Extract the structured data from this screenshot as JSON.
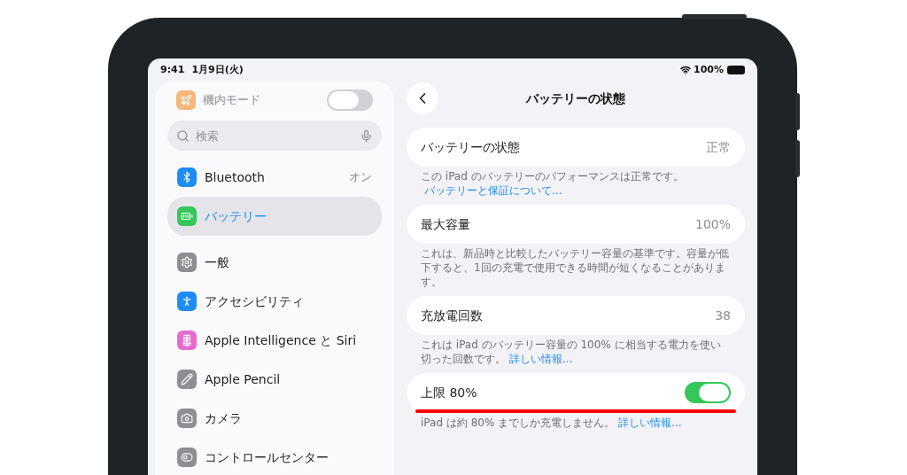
{
  "status_bar": {
    "time": "9:41",
    "date": "1月9日(火)",
    "battery": "100%"
  },
  "sidebar": {
    "search": {
      "placeholder": "検索"
    },
    "items": [
      {
        "kind": "toggle",
        "label": "機内モード",
        "on": false,
        "color": "#f5b77a"
      },
      {
        "kind": "search"
      },
      {
        "kind": "link",
        "label": "Bluetooth",
        "value": "オン",
        "selected": false,
        "color": "#1e8cf5"
      },
      {
        "kind": "link",
        "label": "バッテリー",
        "selected": true,
        "color": "#34c759"
      },
      {
        "kind": "link",
        "label": "一般",
        "selected": false,
        "color": "#8e8e93"
      },
      {
        "kind": "link",
        "label": "アクセシビリティ",
        "selected": false,
        "color": "#1e8cf5"
      },
      {
        "kind": "link",
        "label": "Apple Intelligence と Siri",
        "selected": false,
        "color": "#e86ad0"
      },
      {
        "kind": "link",
        "label": "Apple Pencil",
        "selected": false,
        "color": "#8e8e93"
      },
      {
        "kind": "link",
        "label": "カメラ",
        "selected": false,
        "color": "#8e8e93"
      },
      {
        "kind": "link",
        "label": "コントロールセンター",
        "selected": false,
        "color": "#8e8e93"
      }
    ]
  },
  "detail": {
    "title": "バッテリーの状態",
    "sections": [
      {
        "kind": "value",
        "label": "バッテリーの状態",
        "value": "正常",
        "footer": "この iPad のバッテリーのパフォーマンスは正常です。",
        "link": "バッテリーと保証について...",
        "underlined": false
      },
      {
        "kind": "value",
        "label": "最大容量",
        "value": "100%",
        "footer": "これは、新品時と比較したバッテリー容量の基準です。容量が低下すると、1回の充電で使用できる時間が短くなることがあります。",
        "underlined": false
      },
      {
        "kind": "value",
        "label": "充放電回数",
        "value": "38",
        "footer": "これは iPad のバッテリー容量の 100% に相当する電力を使い切った回数です。",
        "link": "詳しい情報...",
        "underlined": false
      },
      {
        "kind": "toggle",
        "label": "上限 80%",
        "on": true,
        "footer": "iPad は約 80% までしか充電しません。",
        "link": "詳しい情報...",
        "underlined": true
      }
    ]
  }
}
